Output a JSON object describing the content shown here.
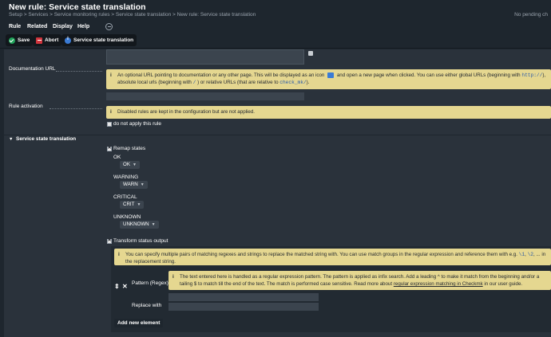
{
  "header": {
    "title": "New rule: Service state translation",
    "breadcrumb": "Setup > Services > Service monitoring rules > Service state translation > New rule: Service state translation",
    "pending": "No pending ch"
  },
  "menu": {
    "items": [
      "Rule",
      "Related",
      "Display",
      "Help"
    ]
  },
  "toolbar": {
    "save_label": "Save",
    "abort_label": "Abort",
    "info_label": "Service state translation"
  },
  "documentation": {
    "label": "Documentation URL",
    "help_part1": "An optional URL pointing to documentation or any other page. This will be displayed as an icon",
    "help_part2": "and open a new page when clicked. You can use either global URLs (beginning with",
    "help_code1": "http://",
    "help_part3": "),",
    "help_part4": "absolute local urls (beginning with",
    "help_code2": "/",
    "help_part5": ") or relative URLs (that are relative to",
    "help_code3": "check_mk/",
    "help_part6": ")."
  },
  "activation": {
    "label": "Rule activation",
    "help": "Disabled rules are kept in the configuration but are not applied.",
    "checkbox_label": "do not apply this rule"
  },
  "section": {
    "title": "Service state translation"
  },
  "remap": {
    "checkbox_label": "Remap states",
    "states": [
      {
        "name": "OK",
        "value": "OK"
      },
      {
        "name": "WARNING",
        "value": "WARN"
      },
      {
        "name": "CRITICAL",
        "value": "CRIT"
      },
      {
        "name": "UNKNOWN",
        "value": "UNKNOWN"
      }
    ]
  },
  "transform": {
    "checkbox_label": "Transform status output",
    "help_part1": "You can specify multiple pairs of matching regexes and strings to replace the matched string with. You can use match groups in the regular expression and reference them with e.g.",
    "help_code1": "\\1",
    "help_sep": ",",
    "help_code2": "\\2",
    "help_part2": ", ... in",
    "help_part3": "the replacement string.",
    "pattern_help_part1": "The text entered here is handled as a regular expression pattern. The pattern is applied as infix search. Add a leading ^ to make it match from the beginning and/or a tailing $ to match till the end of the text. The match is performed case sensitive. Read more about",
    "pattern_help_link": "regular expression matching in Checkmk",
    "pattern_help_part2": "in our user guide.",
    "pattern_label": "Pattern (Regex)",
    "replace_label": "Replace with",
    "add_label": "Add new element"
  }
}
